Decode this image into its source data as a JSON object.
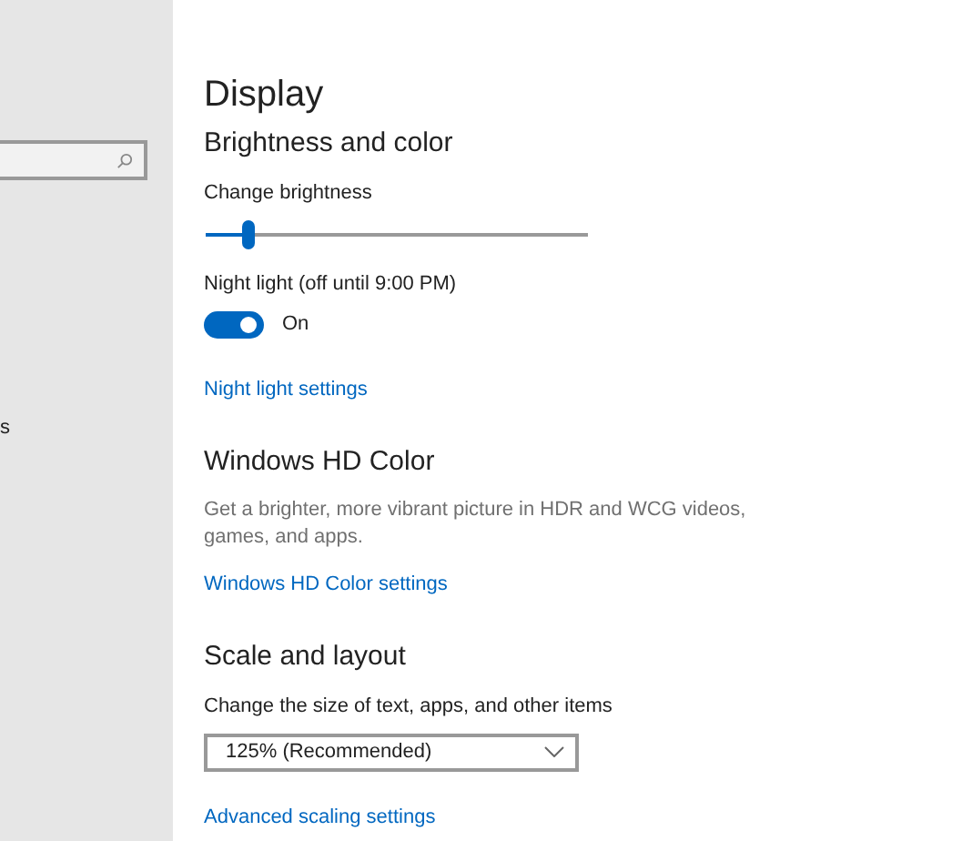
{
  "sidebar": {
    "search_field": true,
    "items": [
      {
        "label": "s"
      }
    ]
  },
  "page": {
    "title": "Display"
  },
  "sections": [
    {
      "heading": "Brightness and color",
      "controls": [
        {
          "kind": "slider",
          "label": "Change brightness",
          "level": 0.11
        },
        {
          "kind": "toggle",
          "label": "Night light (off until 9:00 PM)",
          "on": true,
          "state_text": "On"
        },
        {
          "kind": "link",
          "text": "Night light settings"
        }
      ]
    },
    {
      "heading": "Windows HD Color",
      "controls": [
        {
          "kind": "description",
          "text": "Get a brighter, more vibrant picture in HDR and WCG videos, games, and apps."
        },
        {
          "kind": "link",
          "text": "Windows HD Color settings"
        }
      ]
    },
    {
      "heading": "Scale and layout",
      "controls": [
        {
          "kind": "dropdown",
          "label": "Change the size of text, apps, and other items",
          "value": "125% (Recommended)"
        },
        {
          "kind": "link",
          "text": "Advanced scaling settings"
        }
      ]
    }
  ]
}
